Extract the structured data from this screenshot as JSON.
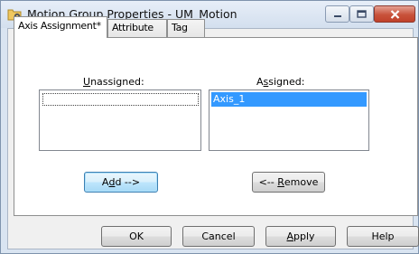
{
  "window": {
    "title": "Motion Group Properties - UM_Motion",
    "colors": {
      "selection": "#3399ff",
      "close_button": "#c8523b"
    }
  },
  "caption_buttons": {
    "minimize_icon": "minimize-icon",
    "maximize_icon": "maximize-icon",
    "close_icon": "close-icon"
  },
  "tabs": [
    {
      "label": "Axis Assignment*",
      "active": true
    },
    {
      "label": "Attribute",
      "active": false
    },
    {
      "label": "Tag",
      "active": false
    }
  ],
  "unassigned": {
    "label_pre": "",
    "label_key": "U",
    "label_post": "nassigned:",
    "items": []
  },
  "assigned": {
    "label_pre": "A",
    "label_key": "s",
    "label_post": "signed:",
    "items": [
      "Axis_1"
    ],
    "selected": "Axis_1"
  },
  "actions": {
    "add_pre": "A",
    "add_key": "d",
    "add_post": "d -->",
    "remove_pre": "<-- ",
    "remove_key": "R",
    "remove_post": "emove"
  },
  "footer": {
    "ok": "OK",
    "cancel": "Cancel",
    "apply_key": "A",
    "apply_post": "pply",
    "help": "Help"
  }
}
